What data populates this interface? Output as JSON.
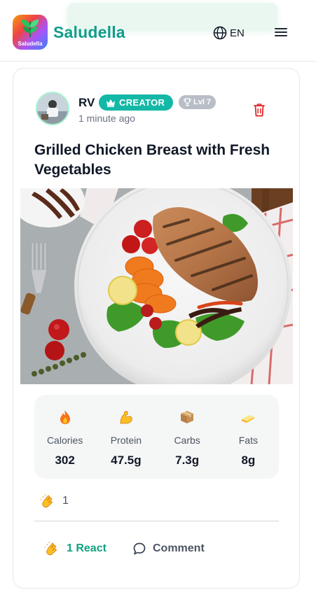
{
  "header": {
    "brand": "Saludella",
    "logo_caption": "Saludella",
    "language": "EN",
    "icons": {
      "globe": "globe-icon",
      "menu": "hamburger-menu-icon"
    }
  },
  "post": {
    "author": "RV",
    "creator_badge": "CREATOR",
    "level_badge": "Lvl 7",
    "timestamp": "1 minute ago",
    "title": "Grilled Chicken Breast with Fresh Vegetables",
    "image_alt": "Grilled chicken breast with tomatoes, carrots, lettuce and lemon on a white plate",
    "nutrition": [
      {
        "icon": "fire-emoji",
        "label": "Calories",
        "value": "302"
      },
      {
        "icon": "flexed-biceps-emoji",
        "label": "Protein",
        "value": "47.5g"
      },
      {
        "icon": "package-emoji",
        "label": "Carbs",
        "value": "7.3g"
      },
      {
        "icon": "butter-emoji",
        "label": "Fats",
        "value": "8g"
      }
    ],
    "reaction_count": "1",
    "actions": {
      "react": "1 React",
      "comment": "Comment"
    }
  },
  "colors": {
    "brand": "#0f9d8a",
    "creator_badge": "#14b8a6",
    "level_badge": "#b9bec6",
    "react_active": "#10a37f",
    "delete": "#dc2626"
  }
}
